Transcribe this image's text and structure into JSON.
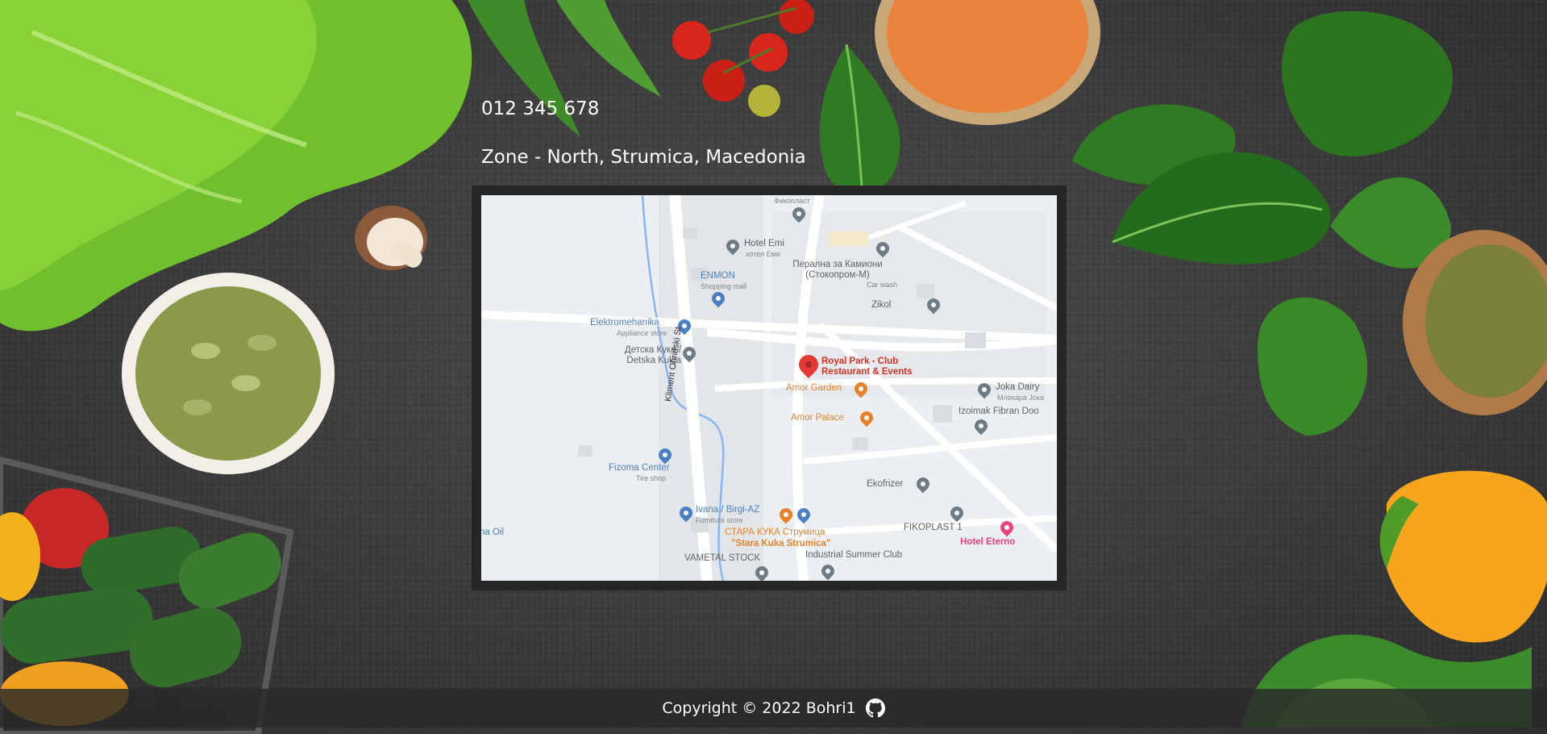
{
  "contact": {
    "phone": "012 345 678",
    "address": "Zone - North, Strumica, Macedonia"
  },
  "map": {
    "street": "Kliment Ohridski St",
    "places": [
      {
        "name": "Фикопласт",
        "sub": "",
        "kind": "gray"
      },
      {
        "name": "Hotel Emi",
        "sub": "хотел Еми",
        "kind": "gray"
      },
      {
        "name": "ENMON",
        "sub": "Shopping mall",
        "kind": "blue"
      },
      {
        "name": "Перална за Камиони (Стокопром-М)",
        "sub": "Car wash",
        "kind": "gray"
      },
      {
        "name": "Zikol",
        "sub": "",
        "kind": "gray"
      },
      {
        "name": "Elektromehanika",
        "sub": "Appliance store",
        "kind": "blue"
      },
      {
        "name": "Детска Кука / Detska Kukja",
        "sub": "",
        "kind": "gray"
      },
      {
        "name": "Royal Park - Club Restaurant & Events",
        "sub": "",
        "kind": "red"
      },
      {
        "name": "Amor Garden",
        "sub": "",
        "kind": "orange"
      },
      {
        "name": "Joka Dairy",
        "sub": "Млекара Јока",
        "kind": "gray"
      },
      {
        "name": "Izoimak Fibran Doo",
        "sub": "",
        "kind": "gray"
      },
      {
        "name": "Amor Palace",
        "sub": "",
        "kind": "orange"
      },
      {
        "name": "Fizoma Center",
        "sub": "Tire shop",
        "kind": "blue"
      },
      {
        "name": "Ekofrizer",
        "sub": "",
        "kind": "gray"
      },
      {
        "name": "Ivana / Birgi-AZ",
        "sub": "Furniture store",
        "kind": "blue"
      },
      {
        "name": "СТАРА КУКА Струмица",
        "sub": "\"Stara Kuka Strumica\"",
        "kind": "orange"
      },
      {
        "name": "FIKOPLAST 1",
        "sub": "",
        "kind": "gray"
      },
      {
        "name": "Hotel Eterno",
        "sub": "",
        "kind": "pink"
      },
      {
        "name": "na Oil",
        "sub": "",
        "kind": "blue"
      },
      {
        "name": "VAMETAL STOCK",
        "sub": "",
        "kind": "gray"
      },
      {
        "name": "Industrial Summer Club",
        "sub": "",
        "kind": "gray"
      }
    ]
  },
  "footer": {
    "copyright": "Copyright © 2022 Bohri1",
    "icon": "github-icon"
  }
}
